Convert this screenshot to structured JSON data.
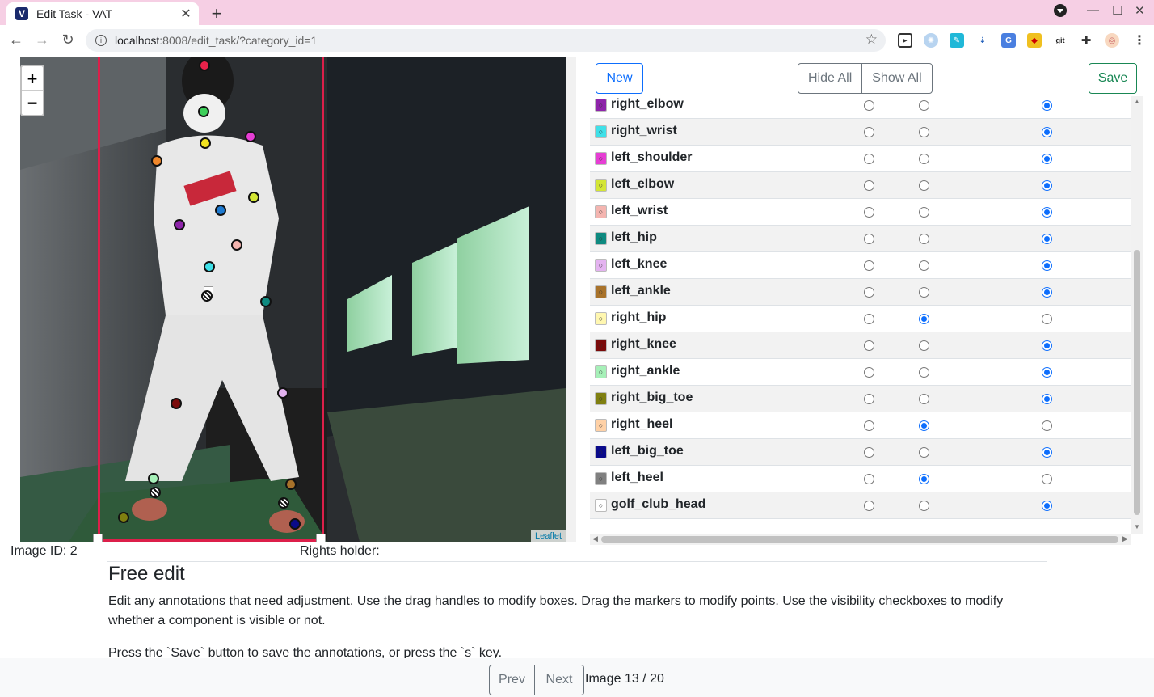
{
  "browser": {
    "tab_title": "Edit Task - VAT",
    "favicon_letter": "V",
    "url_host": "localhost",
    "url_rest": ":8008/edit_task/?category_id=1"
  },
  "map": {
    "zoom_in": "+",
    "zoom_out": "−",
    "attribution": "Leaflet",
    "bbox_color": "#dc1f4a"
  },
  "meta": {
    "image_id": "Image ID: 2",
    "rights_holder": "Rights holder:"
  },
  "toolbar": {
    "new_label": "New",
    "hide_all_label": "Hide All",
    "show_all_label": "Show All",
    "save_label": "Save"
  },
  "keypoints": [
    {
      "name": "right_elbow",
      "color": "#8e24aa",
      "visibility": 2
    },
    {
      "name": "right_wrist",
      "color": "#3fe0e8",
      "visibility": 2
    },
    {
      "name": "left_shoulder",
      "color": "#e63ed4",
      "visibility": 2
    },
    {
      "name": "left_elbow",
      "color": "#d4e635",
      "visibility": 2
    },
    {
      "name": "left_wrist",
      "color": "#f4b5b0",
      "visibility": 2
    },
    {
      "name": "left_hip",
      "color": "#0e8a80",
      "visibility": 2
    },
    {
      "name": "left_knee",
      "color": "#e4b3f0",
      "visibility": 2
    },
    {
      "name": "left_ankle",
      "color": "#a8722a",
      "visibility": 2
    },
    {
      "name": "right_hip",
      "color": "#fff7b0",
      "visibility": 1
    },
    {
      "name": "right_knee",
      "color": "#7a0a0a",
      "visibility": 2
    },
    {
      "name": "right_ankle",
      "color": "#a6f0b8",
      "visibility": 2
    },
    {
      "name": "right_big_toe",
      "color": "#7f7f10",
      "visibility": 2
    },
    {
      "name": "right_heel",
      "color": "#ffd1a6",
      "visibility": 1
    },
    {
      "name": "left_big_toe",
      "color": "#0a0a8a",
      "visibility": 2
    },
    {
      "name": "left_heel",
      "color": "#808080",
      "visibility": 1
    },
    {
      "name": "golf_club_head",
      "color": "#ffffff",
      "visibility": 2
    }
  ],
  "instructions": {
    "title": "Free edit",
    "p1": "Edit any annotations that need adjustment. Use the drag handles to modify boxes. Drag the markers to modify points. Use the visibility checkboxes to modify whether a component is visible or not.",
    "p2": "Press the `Save` button to save the annotations, or press the `s` key."
  },
  "footer": {
    "prev_label": "Prev",
    "next_label": "Next",
    "counter": "Image 13 / 20"
  }
}
